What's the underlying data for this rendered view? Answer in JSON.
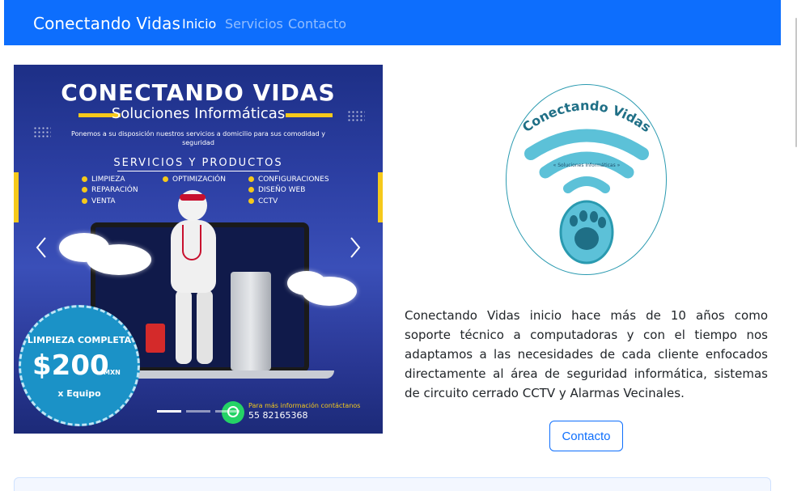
{
  "navbar": {
    "brand": "Conectando Vidas",
    "links": [
      {
        "label": "Inicio",
        "active": true
      },
      {
        "label": "Servicios",
        "active": false
      },
      {
        "label": "Contacto",
        "active": false
      }
    ],
    "bg_color": "#0d6efd"
  },
  "carousel": {
    "title": "CONECTANDO VIDAS",
    "subtitle": "Soluciones Informáticas",
    "description": "Ponemos a su disposición nuestros servicios a domicilio para sus comodidad y seguridad",
    "section_title": "SERVICIOS Y PRODUCTOS",
    "services": [
      "LIMPIEZA",
      "REPARACIÓN",
      "VENTA",
      "OPTIMIZACIÓN",
      "CONFIGURACIONES",
      "DISEÑO WEB",
      "CCTV"
    ],
    "badge": {
      "line1": "LIMPIEZA COMPLETA",
      "price": "$200",
      "currency": "MXN",
      "line3": "x Equipo"
    },
    "contact_text": "Para más información contáctanos",
    "phone": "55 82165368",
    "indicators": 3,
    "active_indicator": 0
  },
  "logo": {
    "name": "Conectando Vidas",
    "tagline": "« Soluciones Informáticas »",
    "color": "#2a9ab0"
  },
  "about": {
    "text": "Conectando Vidas inicio hace más de 10 años como soporte técnico a computadoras y con el tiempo nos adaptamos a las necesidades de cada cliente enfocados directamente al área de seguridad informática, sistemas de circuito cerrado CCTV y Alarmas Vecinales."
  },
  "contact_button": {
    "label": "Contacto"
  }
}
